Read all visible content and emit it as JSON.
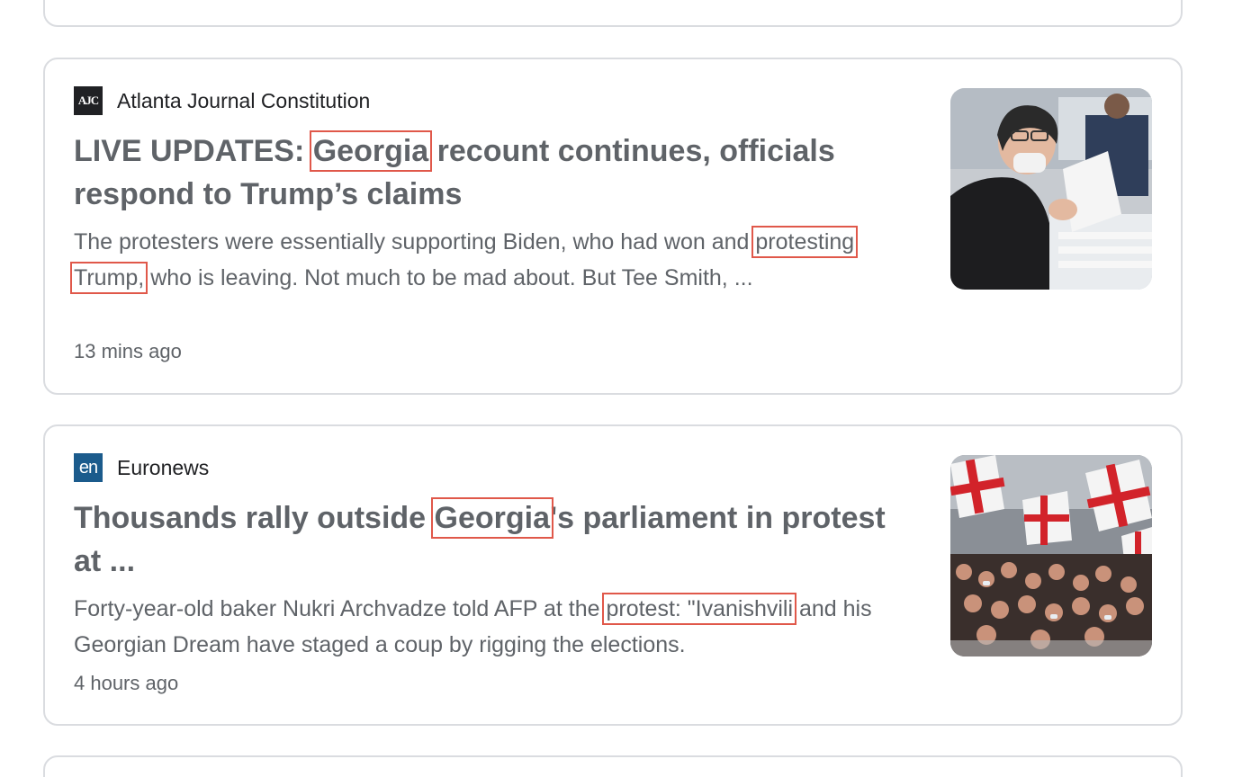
{
  "articles": [
    {
      "source": "Atlanta Journal Constitution",
      "logo_text": "AJC",
      "headline_pre": "LIVE UPDATES: ",
      "headline_hl": "Georgia",
      "headline_post": " recount continues, officials respond to Trump’s claims",
      "snippet_pre": "The protesters were essentially supporting Biden, who had won and ",
      "snippet_hl": "protesting Trump,",
      "snippet_post": " who is leaving. Not much to be mad about. But Tee Smith, ...",
      "time": "13 mins ago",
      "thumbnail": "photo-person-counting-ballots"
    },
    {
      "source": "Euronews",
      "logo_text": "en",
      "headline_pre": "Thousands rally outside ",
      "headline_hl": "Georgia",
      "headline_post": "'s parliament in protest at ...",
      "snippet_pre": "Forty-year-old baker Nukri Archvadze told AFP at the ",
      "snippet_hl": "protest: \"Ivanishvili",
      "snippet_post": " and his Georgian Dream have staged a coup by rigging the elections.",
      "time": "4 hours ago",
      "thumbnail": "photo-crowd-with-flags"
    }
  ],
  "colors": {
    "card_border": "#dadce0",
    "text_primary": "#202124",
    "text_secondary": "#5f6368",
    "highlight_box": "#e0584a"
  }
}
